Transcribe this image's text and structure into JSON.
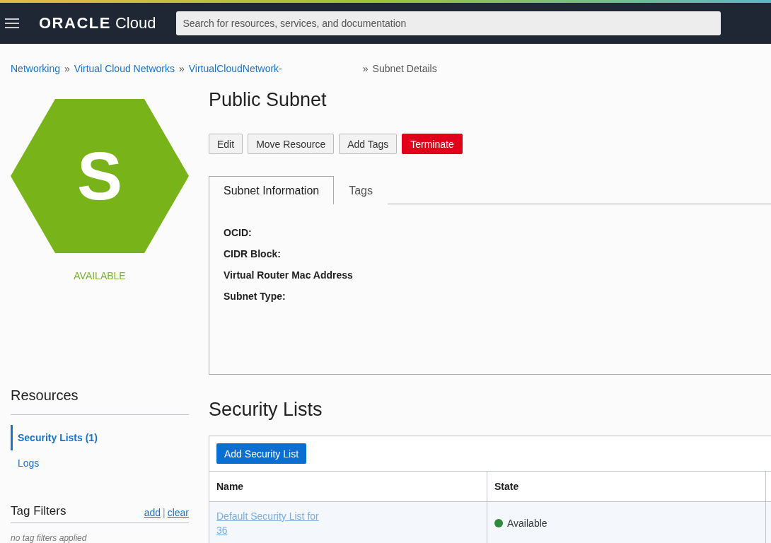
{
  "header": {
    "logo": "ORACLE",
    "logo_suffix": "Cloud",
    "search": {
      "placeholder": "Search for resources, services, and documentation"
    }
  },
  "breadcrumb": [
    {
      "label": "Networking",
      "kind": "link"
    },
    {
      "label": "Virtual Cloud Networks",
      "kind": "link"
    },
    {
      "label": "VirtualCloudNetwork-",
      "kind": "link"
    },
    {
      "label": "Subnet Details",
      "kind": "current"
    }
  ],
  "separator": "»",
  "resource": {
    "letter": "S",
    "status": "AVAILABLE"
  },
  "sidebar": {
    "title": "Resources",
    "items": [
      {
        "label": "Security Lists (1)",
        "selected": true
      },
      {
        "label": "Logs",
        "selected": false
      }
    ],
    "tag_filters": {
      "title": "Tag Filters",
      "add": "add",
      "divider": "|",
      "clear": "clear",
      "empty": "no tag filters applied"
    }
  },
  "page_title": "Public Subnet",
  "actions": [
    {
      "label": "Edit",
      "kind": "default"
    },
    {
      "label": "Move Resource",
      "kind": "default"
    },
    {
      "label": "Add Tags",
      "kind": "default"
    },
    {
      "label": "Terminate",
      "kind": "danger"
    }
  ],
  "tabs": [
    {
      "label": "Subnet Information",
      "selected": true
    },
    {
      "label": "Tags",
      "selected": false
    }
  ],
  "info": [
    "OCID:",
    "CIDR Block:",
    "Virtual Router Mac Address",
    "Subnet Type:"
  ],
  "section_title": "Security Lists",
  "add_button": "Add Security List",
  "table": {
    "columns": [
      "Name",
      "State"
    ],
    "rows": [
      {
        "name": [
          "Default Security List for",
          "36"
        ],
        "state": "Available",
        "color": "#2f8a3b"
      }
    ]
  }
}
